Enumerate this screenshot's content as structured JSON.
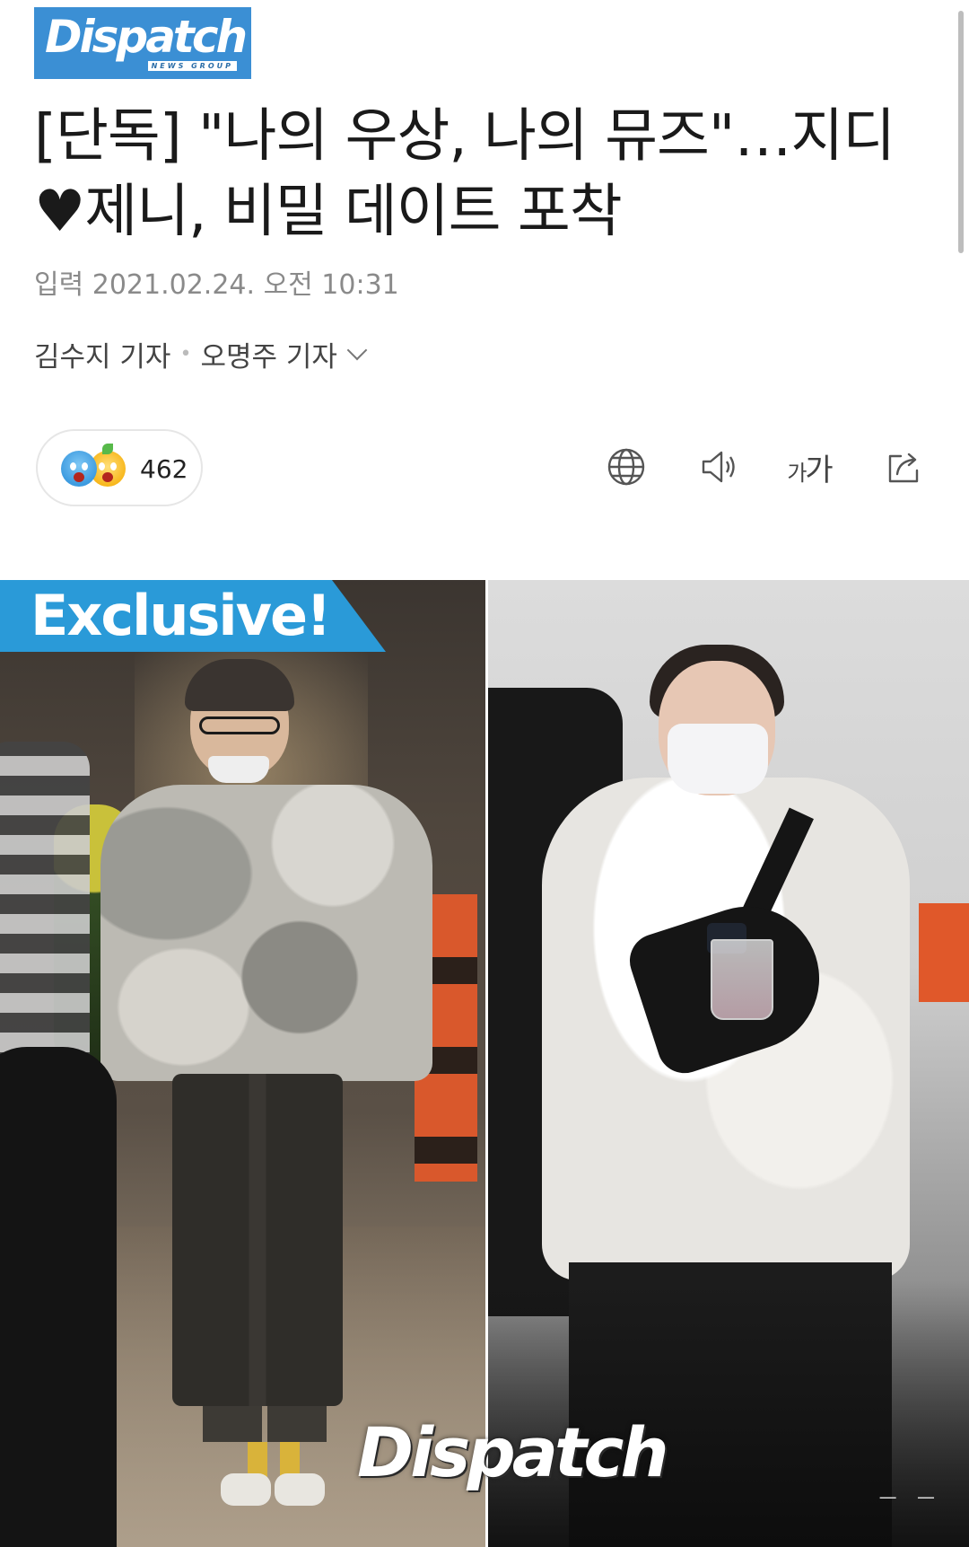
{
  "header": {
    "logo_text": "Dispatch",
    "logo_sub": "NEWS GROUP",
    "logo_color": "#3b8fd4"
  },
  "article": {
    "headline": "[단독] \"나의 우상, 나의 뮤즈\"…지디♥제니, 비밀 데이트 포착",
    "date": "입력 2021.02.24. 오전 10:31",
    "reporter_1": "김수지 기자",
    "reporter_2": "오명주 기자"
  },
  "reactions": {
    "count": "462",
    "emoji_icons": [
      "surprised-blue-emoji-icon",
      "surprised-yellow-emoji-icon"
    ]
  },
  "toolbar": {
    "icons": [
      "globe-icon",
      "speaker-icon",
      "font-size-icon",
      "share-icon"
    ],
    "font_label_small": "가",
    "font_label_large": "가"
  },
  "photo": {
    "banner_text": "Exclusive!",
    "banner_color": "#2a9ad8",
    "watermark_text": "Dispatch"
  }
}
